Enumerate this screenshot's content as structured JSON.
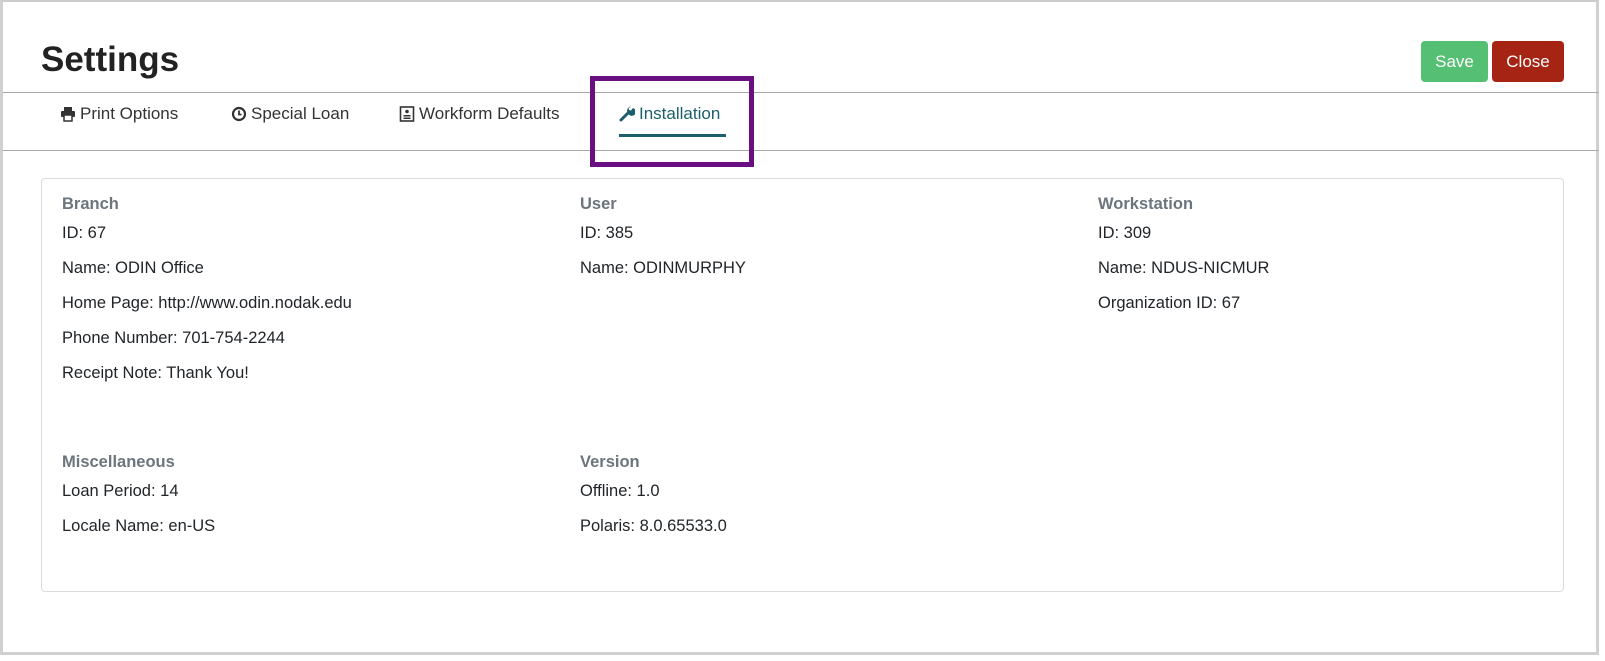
{
  "header": {
    "title": "Settings",
    "save_label": "Save",
    "close_label": "Close",
    "save_color": "#55bf73",
    "close_color": "#a52414"
  },
  "tabs": [
    {
      "label": "Print Options",
      "icon": "print-icon"
    },
    {
      "label": "Special Loan",
      "icon": "clock-icon"
    },
    {
      "label": "Workform Defaults",
      "icon": "form-icon"
    },
    {
      "label": "Installation",
      "icon": "wrench-icon",
      "active": true
    }
  ],
  "sections": {
    "branch": {
      "title": "Branch",
      "rows": [
        "ID: 67",
        "Name: ODIN Office",
        "Home Page: http://www.odin.nodak.edu",
        "Phone Number: 701-754-2244",
        "Receipt Note: Thank You!"
      ]
    },
    "user": {
      "title": "User",
      "rows": [
        "ID: 385",
        "Name: ODINMURPHY"
      ]
    },
    "workstation": {
      "title": "Workstation",
      "rows": [
        "ID: 309",
        "Name: NDUS-NICMUR",
        "Organization ID: 67"
      ]
    },
    "misc": {
      "title": "Miscellaneous",
      "rows": [
        "Loan Period: 14",
        "Locale Name: en-US"
      ]
    },
    "version": {
      "title": "Version",
      "rows": [
        "Offline: 1.0",
        "Polaris: 8.0.65533.0"
      ]
    }
  },
  "highlight_color": "#6a0f82"
}
